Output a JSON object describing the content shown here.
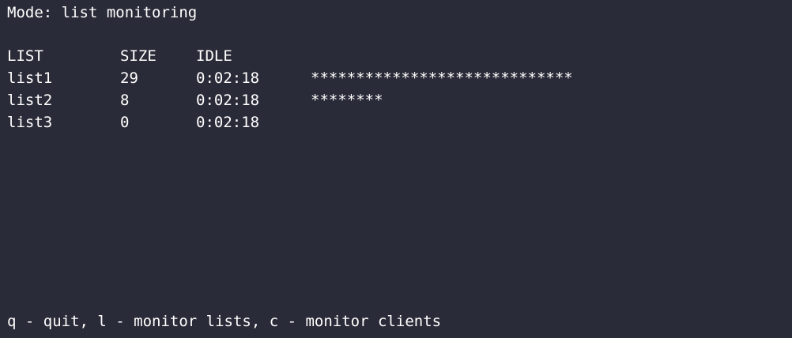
{
  "mode_line": "Mode: list monitoring",
  "table": {
    "headers": {
      "list": "LIST",
      "size": "SIZE",
      "idle": "IDLE"
    },
    "rows": [
      {
        "name": "list1",
        "size": "29",
        "idle": "0:02:18",
        "bar": "*****************************"
      },
      {
        "name": "list2",
        "size": "8",
        "idle": "0:02:18",
        "bar": "********"
      },
      {
        "name": "list3",
        "size": "0",
        "idle": "0:02:18",
        "bar": ""
      }
    ]
  },
  "help_line": "q - quit, l - monitor lists, c - monitor clients",
  "colors": {
    "background": "#2a2b38",
    "text": "#ffffff"
  }
}
